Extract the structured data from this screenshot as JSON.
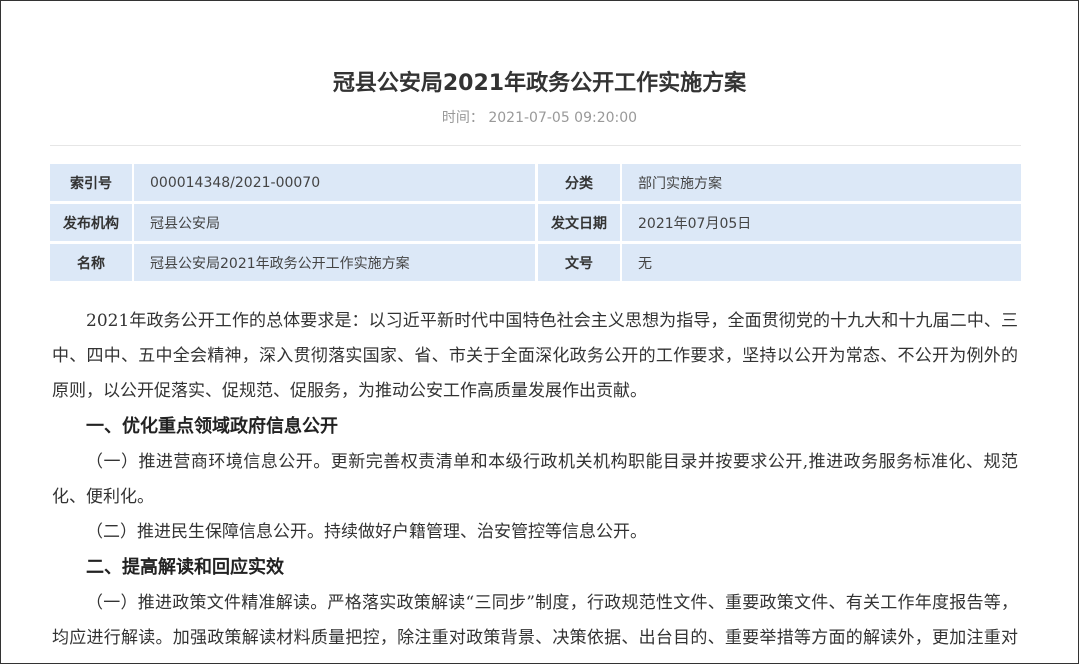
{
  "article": {
    "title": "冠县公安局2021年政务公开工作实施方案",
    "meta": "时间：  2021-07-05 09:20:00"
  },
  "info": {
    "rows": [
      {
        "l1": "索引号",
        "v1": "000014348/2021-00070",
        "l2": "分类",
        "v2": "部门实施方案"
      },
      {
        "l1": "发布机构",
        "v1": "冠县公安局",
        "l2": "发文日期",
        "v2": "2021年07月05日"
      },
      {
        "l1": "名称",
        "v1": "冠县公安局2021年政务公开工作实施方案",
        "l2": "文号",
        "v2": "无"
      }
    ]
  },
  "body": {
    "p1": "2021年政务公开工作的总体要求是：以习近平新时代中国特色社会主义思想为指导，全面贯彻党的十九大和十九届二中、三中、四中、五中全会精神，深入贯彻落实国家、省、市关于全面深化政务公开的工作要求，坚持以公开为常态、不公开为例外的原则，以公开促落实、促规范、促服务，为推动公安工作高质量发展作出贡献。",
    "h1": "一、优化重点领域政府信息公开",
    "p2": "（一）推进营商环境信息公开。更新完善权责清单和本级行政机关机构职能目录并按要求公开,推进政务服务标准化、规范化、便利化。",
    "p3": "（二）推进民生保障信息公开。持续做好户籍管理、治安管控等信息公开。",
    "h2": "二、提高解读和回应实效",
    "p4": "（一）推进政策文件精准解读。严格落实政策解读“三同步”制度，行政规范性文件、重要政策文件、有关工作年度报告等，均应进行解读。加强政策解读材料质量把控，除注重对政策背景、决策依据、出台目的、重要举措等方面的解读外，更加注重对政策措施的解读。"
  }
}
